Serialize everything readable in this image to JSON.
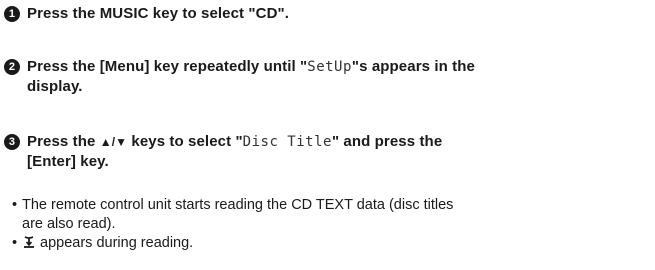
{
  "steps": [
    {
      "number": "1",
      "text_before": "Press the MUSIC key to select \"CD\"."
    },
    {
      "number": "2",
      "text_before": "Press the [Menu] key repeatedly until \"",
      "display": "SetUp",
      "text_after": "\"s appears in the",
      "text_line2": "display."
    },
    {
      "number": "3",
      "text_before": "Press the ",
      "up_down": "▲/▼",
      "text_mid": " keys to select \"",
      "display": "Disc Title",
      "text_after": "\" and press the",
      "text_line2": "[Enter] key."
    }
  ],
  "bullets": [
    {
      "line1": "The remote  control unit starts reading the CD TEXT data (disc titles",
      "line2": "are also read)."
    },
    {
      "text": "appears during reading.",
      "icon": "reading-indicator-icon"
    }
  ]
}
